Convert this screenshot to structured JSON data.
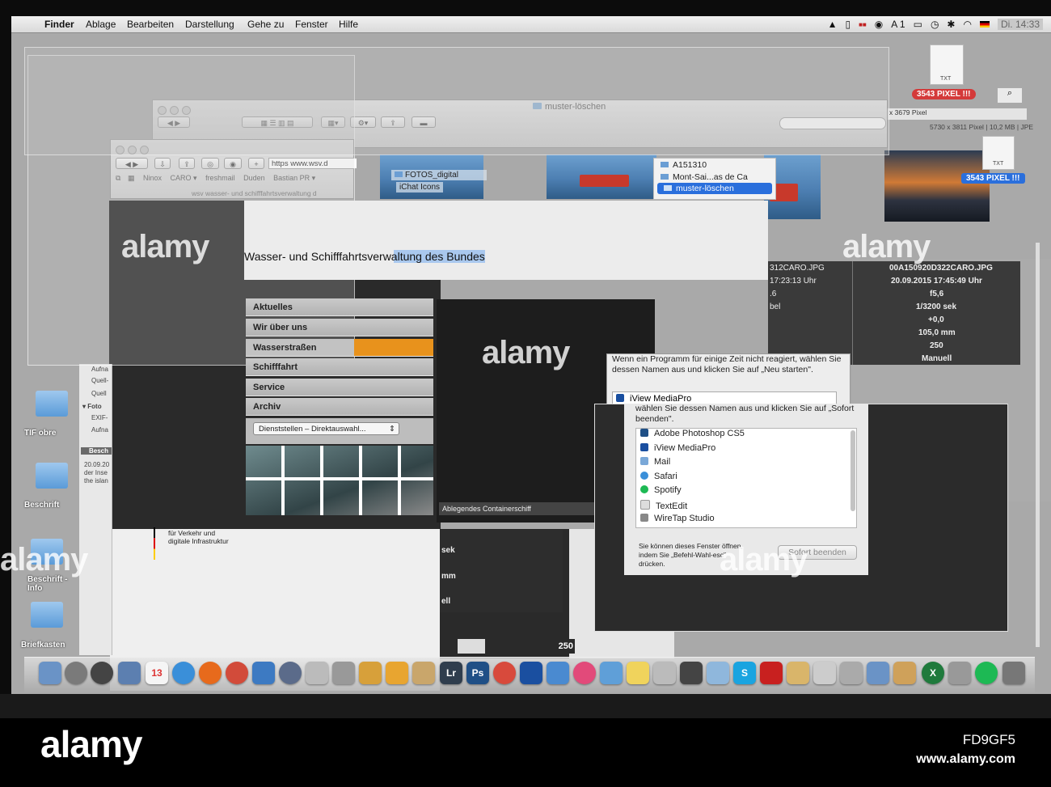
{
  "menubar": {
    "app": "Finder",
    "items": [
      "Ablage",
      "Bearbeiten",
      "Darstellung",
      "Gehe zu",
      "Fenster",
      "Hilfe"
    ],
    "input_source": "A 1",
    "clock": "Di. 14:33"
  },
  "finder_window": {
    "title": "muster-löschen",
    "folders": [
      "FOTOS_digital",
      "iChat Icons"
    ],
    "popup_items": [
      "A151310",
      "Mont-Sai...as de Ca",
      "muster-löschen"
    ]
  },
  "browser": {
    "url": "https www.wsv.d",
    "bookmarks": [
      "Ninox",
      "CARO ▾",
      "freshmail",
      "Duden",
      "Bastian PR ▾"
    ],
    "tab_title": "wsv wasser- und schifffahrtsverwaltung d",
    "headline": "Wasser- und Schifffahrtsverwaltung des Bundes",
    "nav": [
      "Aktuelles",
      "Wir über uns",
      "Wasserstraßen",
      "Schifffahrt",
      "Service",
      "Archiv"
    ],
    "select_value": "Dienststellen – Direktauswahl...",
    "caption": "Ablegendes Containerschiff",
    "ministry_lines": [
      "für Verkehr und",
      "digitale Infrastruktur"
    ]
  },
  "badges": {
    "pixel": "3543 PIXEL !!!",
    "txt": "TXT"
  },
  "image_info": {
    "dims1": "x 3679 Pixel",
    "dims2": "5730 x 3811 Pixel",
    "size": "10,2 MB",
    "fmt": "JPE"
  },
  "metadata": {
    "col1": [
      "312CARO.JPG",
      "17:23:13 Uhr",
      ".6",
      "bel"
    ],
    "col2": [
      "00A150920D322CARO.JPG",
      "20.09.2015 17:45:49 Uhr",
      "f5,6",
      "1/3200 sek",
      "+0,0",
      "105,0 mm",
      "250",
      "Manuell"
    ],
    "lower": [
      "sek",
      "mm",
      "ell"
    ],
    "iso": "250"
  },
  "side_panel": {
    "items": [
      "Aufna",
      "Quell-",
      "Quell",
      "Foto",
      "EXIF-",
      "Aufna",
      "Besch"
    ],
    "desc": [
      "20.09.20",
      "der Inse",
      "the islan"
    ]
  },
  "desktop_icons": [
    "TIF obre",
    "Beschrift",
    "Beschrift -Info",
    "Briefkasten"
  ],
  "force_quit": {
    "msg1": "Wenn ein Programm für einige Zeit nicht reagiert, wählen Sie dessen Namen aus und klicken Sie auf „Neu starten\".",
    "selected_app": "iView MediaPro",
    "msg2": "wählen Sie dessen Namen aus und klicken Sie auf „Sofort beenden\".",
    "apps": [
      "Adobe Photoshop CS5",
      "iView MediaPro",
      "Mail",
      "Safari",
      "Spotify",
      "TextEdit",
      "WireTap Studio"
    ],
    "hint": "Sie können dieses Fenster öffnen, indem Sie „Befehl-Wahl-esc\" drücken.",
    "button": "Sofort beenden"
  },
  "dock": {
    "labels": [
      "13",
      "Lr",
      "Ps",
      "S",
      "X"
    ],
    "colors": {
      "lightroom": "#2f3d4d",
      "photoshop": "#1f4f86",
      "skype": "#1aa4e0",
      "acrobat": "#c8201f",
      "excel": "#1f7a3c",
      "spotify": "#1db954"
    }
  },
  "watermark": {
    "text": "alamy",
    "image_id": "FD9GF5",
    "url": "www.alamy.com"
  },
  "colors": {
    "accent_orange": "#e8921c",
    "selection_blue": "#2a6fdc",
    "badge_red": "#e0383a"
  }
}
